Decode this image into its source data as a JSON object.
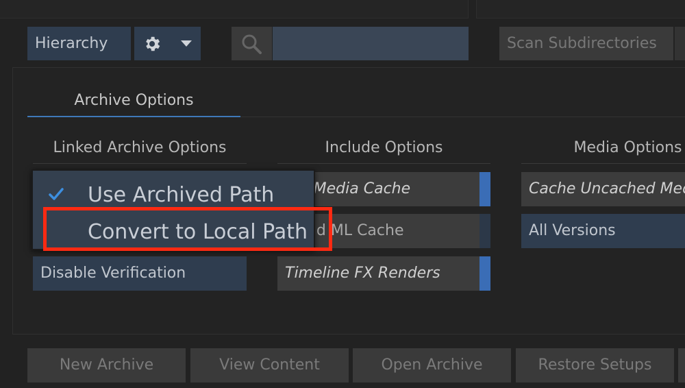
{
  "toolbar": {
    "hierarchy_label": "Hierarchy",
    "search_placeholder": "",
    "scan_label": "Scan Subdirectories"
  },
  "tabs": [
    {
      "label": "Archive Options",
      "selected": true
    }
  ],
  "sections": {
    "linked": {
      "header": "Linked Archive Options",
      "disable_verification": "Disable Verification"
    },
    "include": {
      "header": "Include Options",
      "items": [
        {
          "label": "rce Media Cache",
          "enabled": true
        },
        {
          "label": "s and ML Cache",
          "enabled": false
        },
        {
          "label": "Timeline FX Renders",
          "enabled": true
        }
      ]
    },
    "media": {
      "header": "Media Options",
      "items": [
        {
          "label": "Cache Uncached Medi"
        },
        {
          "label": "All Versions"
        }
      ]
    }
  },
  "dropdown": {
    "items": [
      {
        "label": "Use Archived Path",
        "checked": true
      },
      {
        "label": "Convert to Local Path",
        "checked": false
      }
    ]
  },
  "bottom_buttons": [
    "New Archive",
    "View Content",
    "Open Archive",
    "Restore Setups"
  ],
  "colors": {
    "accent": "#3a6db6",
    "highlight": "#ff2a12"
  }
}
